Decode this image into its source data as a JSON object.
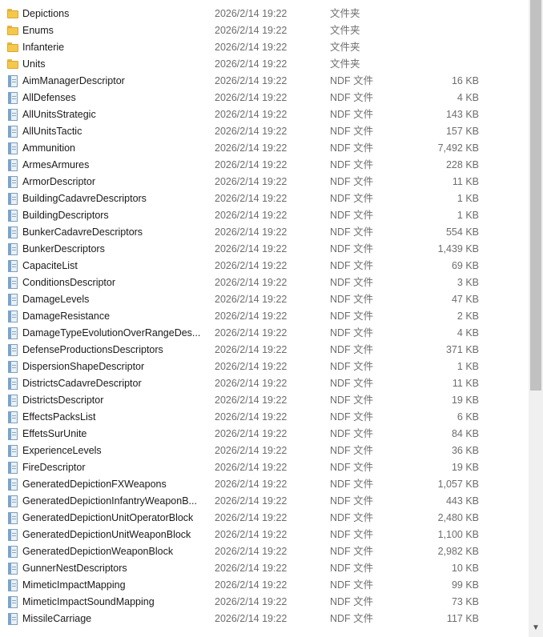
{
  "files": [
    {
      "name": "Depictions",
      "date": "2026/2/14 19:22",
      "type": "文件夹",
      "size": "",
      "kind": "folder"
    },
    {
      "name": "Enums",
      "date": "2026/2/14 19:22",
      "type": "文件夹",
      "size": "",
      "kind": "folder"
    },
    {
      "name": "Infanterie",
      "date": "2026/2/14 19:22",
      "type": "文件夹",
      "size": "",
      "kind": "folder"
    },
    {
      "name": "Units",
      "date": "2026/2/14 19:22",
      "type": "文件夹",
      "size": "",
      "kind": "folder"
    },
    {
      "name": "AimManagerDescriptor",
      "date": "2026/2/14 19:22",
      "type": "NDF 文件",
      "size": "16 KB",
      "kind": "file"
    },
    {
      "name": "AllDefenses",
      "date": "2026/2/14 19:22",
      "type": "NDF 文件",
      "size": "4 KB",
      "kind": "file"
    },
    {
      "name": "AllUnitsStrategic",
      "date": "2026/2/14 19:22",
      "type": "NDF 文件",
      "size": "143 KB",
      "kind": "file"
    },
    {
      "name": "AllUnitsTactic",
      "date": "2026/2/14 19:22",
      "type": "NDF 文件",
      "size": "157 KB",
      "kind": "file"
    },
    {
      "name": "Ammunition",
      "date": "2026/2/14 19:22",
      "type": "NDF 文件",
      "size": "7,492 KB",
      "kind": "file"
    },
    {
      "name": "ArmesArmures",
      "date": "2026/2/14 19:22",
      "type": "NDF 文件",
      "size": "228 KB",
      "kind": "file"
    },
    {
      "name": "ArmorDescriptor",
      "date": "2026/2/14 19:22",
      "type": "NDF 文件",
      "size": "11 KB",
      "kind": "file"
    },
    {
      "name": "BuildingCadavreDescriptors",
      "date": "2026/2/14 19:22",
      "type": "NDF 文件",
      "size": "1 KB",
      "kind": "file"
    },
    {
      "name": "BuildingDescriptors",
      "date": "2026/2/14 19:22",
      "type": "NDF 文件",
      "size": "1 KB",
      "kind": "file"
    },
    {
      "name": "BunkerCadavreDescriptors",
      "date": "2026/2/14 19:22",
      "type": "NDF 文件",
      "size": "554 KB",
      "kind": "file"
    },
    {
      "name": "BunkerDescriptors",
      "date": "2026/2/14 19:22",
      "type": "NDF 文件",
      "size": "1,439 KB",
      "kind": "file"
    },
    {
      "name": "CapaciteList",
      "date": "2026/2/14 19:22",
      "type": "NDF 文件",
      "size": "69 KB",
      "kind": "file"
    },
    {
      "name": "ConditionsDescriptor",
      "date": "2026/2/14 19:22",
      "type": "NDF 文件",
      "size": "3 KB",
      "kind": "file"
    },
    {
      "name": "DamageLevels",
      "date": "2026/2/14 19:22",
      "type": "NDF 文件",
      "size": "47 KB",
      "kind": "file"
    },
    {
      "name": "DamageResistance",
      "date": "2026/2/14 19:22",
      "type": "NDF 文件",
      "size": "2 KB",
      "kind": "file"
    },
    {
      "name": "DamageTypeEvolutionOverRangeDes...",
      "date": "2026/2/14 19:22",
      "type": "NDF 文件",
      "size": "4 KB",
      "kind": "file"
    },
    {
      "name": "DefenseProductionsDescriptors",
      "date": "2026/2/14 19:22",
      "type": "NDF 文件",
      "size": "371 KB",
      "kind": "file"
    },
    {
      "name": "DispersionShapeDescriptor",
      "date": "2026/2/14 19:22",
      "type": "NDF 文件",
      "size": "1 KB",
      "kind": "file"
    },
    {
      "name": "DistrictsCadavreDescriptor",
      "date": "2026/2/14 19:22",
      "type": "NDF 文件",
      "size": "11 KB",
      "kind": "file"
    },
    {
      "name": "DistrictsDescriptor",
      "date": "2026/2/14 19:22",
      "type": "NDF 文件",
      "size": "19 KB",
      "kind": "file"
    },
    {
      "name": "EffectsPacksList",
      "date": "2026/2/14 19:22",
      "type": "NDF 文件",
      "size": "6 KB",
      "kind": "file"
    },
    {
      "name": "EffetsSurUnite",
      "date": "2026/2/14 19:22",
      "type": "NDF 文件",
      "size": "84 KB",
      "kind": "file"
    },
    {
      "name": "ExperienceLevels",
      "date": "2026/2/14 19:22",
      "type": "NDF 文件",
      "size": "36 KB",
      "kind": "file"
    },
    {
      "name": "FireDescriptor",
      "date": "2026/2/14 19:22",
      "type": "NDF 文件",
      "size": "19 KB",
      "kind": "file"
    },
    {
      "name": "GeneratedDepictionFXWeapons",
      "date": "2026/2/14 19:22",
      "type": "NDF 文件",
      "size": "1,057 KB",
      "kind": "file"
    },
    {
      "name": "GeneratedDepictionInfantryWeaponB...",
      "date": "2026/2/14 19:22",
      "type": "NDF 文件",
      "size": "443 KB",
      "kind": "file"
    },
    {
      "name": "GeneratedDepictionUnitOperatorBlock",
      "date": "2026/2/14 19:22",
      "type": "NDF 文件",
      "size": "2,480 KB",
      "kind": "file"
    },
    {
      "name": "GeneratedDepictionUnitWeaponBlock",
      "date": "2026/2/14 19:22",
      "type": "NDF 文件",
      "size": "1,100 KB",
      "kind": "file"
    },
    {
      "name": "GeneratedDepictionWeaponBlock",
      "date": "2026/2/14 19:22",
      "type": "NDF 文件",
      "size": "2,982 KB",
      "kind": "file"
    },
    {
      "name": "GunnerNestDescriptors",
      "date": "2026/2/14 19:22",
      "type": "NDF 文件",
      "size": "10 KB",
      "kind": "file"
    },
    {
      "name": "MimeticImpactMapping",
      "date": "2026/2/14 19:22",
      "type": "NDF 文件",
      "size": "99 KB",
      "kind": "file"
    },
    {
      "name": "MimeticImpactSoundMapping",
      "date": "2026/2/14 19:22",
      "type": "NDF 文件",
      "size": "73 KB",
      "kind": "file"
    },
    {
      "name": "MissileCarriage",
      "date": "2026/2/14 19:22",
      "type": "NDF 文件",
      "size": "117 KB",
      "kind": "file"
    }
  ],
  "icons": {
    "folder": "folder-icon",
    "file": "ndf-file-icon",
    "scroll_down": "chevron-down-icon"
  }
}
